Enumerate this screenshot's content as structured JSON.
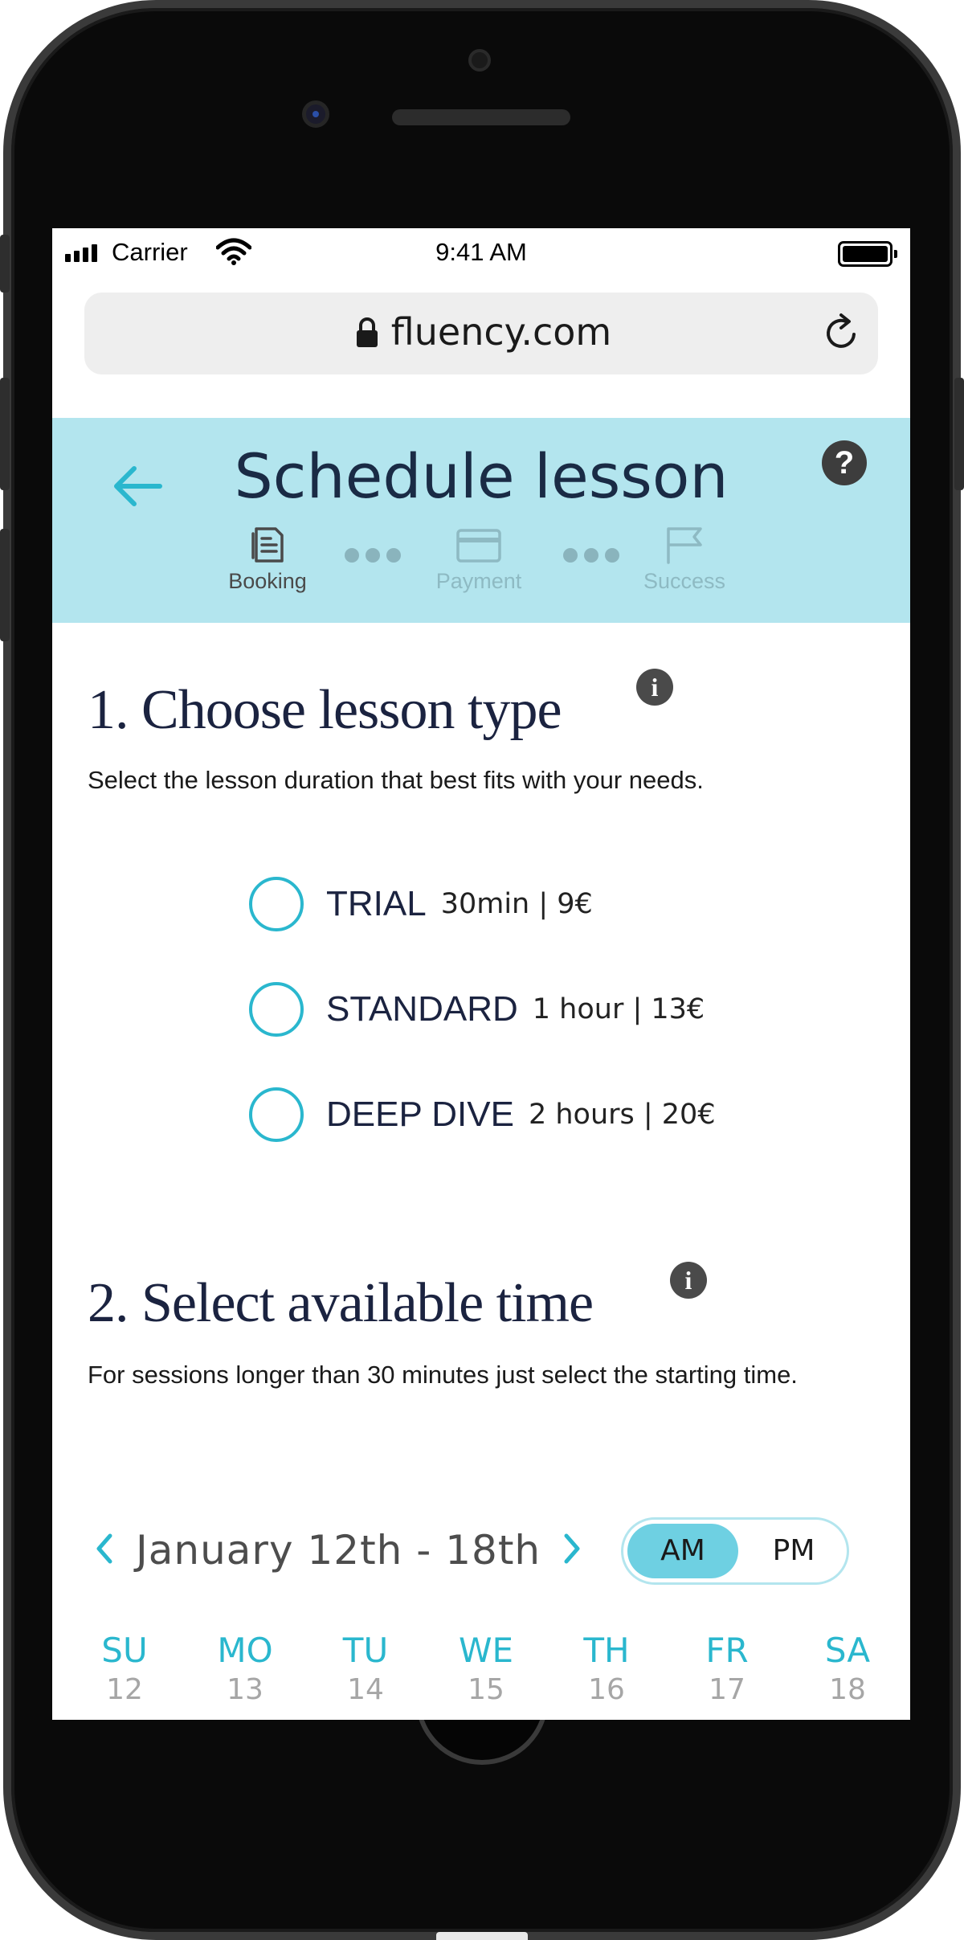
{
  "status_bar": {
    "carrier": "Carrier",
    "time": "9:41 AM"
  },
  "browser": {
    "url": "fluency.com"
  },
  "header": {
    "title": "Schedule lesson",
    "steps": [
      {
        "label": "Booking",
        "state": "active"
      },
      {
        "label": "Payment",
        "state": "inactive"
      },
      {
        "label": "Success",
        "state": "inactive"
      }
    ]
  },
  "lesson_type": {
    "title": "1. Choose lesson type",
    "description": "Select the lesson duration that best fits with your needs.",
    "options": [
      {
        "name": "TRIAL",
        "detail": "30min | 9€"
      },
      {
        "name": "STANDARD",
        "detail": "1 hour | 13€"
      },
      {
        "name": "DEEP DIVE",
        "detail": "2 hours | 20€"
      }
    ]
  },
  "time_select": {
    "title": "2. Select available time",
    "description": "For sessions longer than 30 minutes just select the starting time.",
    "week_label": "January 12th - 18th",
    "am_label": "AM",
    "pm_label": "PM",
    "selected_period": "AM",
    "days": [
      {
        "dow": "SU",
        "num": "12"
      },
      {
        "dow": "MO",
        "num": "13"
      },
      {
        "dow": "TU",
        "num": "14"
      },
      {
        "dow": "WE",
        "num": "15"
      },
      {
        "dow": "TH",
        "num": "16"
      },
      {
        "dow": "FR",
        "num": "17"
      },
      {
        "dow": "SA",
        "num": "18"
      }
    ]
  },
  "colors": {
    "accent": "#2ab7ce",
    "header_bg": "#b3e5ee",
    "title_navy": "#1b2340"
  }
}
